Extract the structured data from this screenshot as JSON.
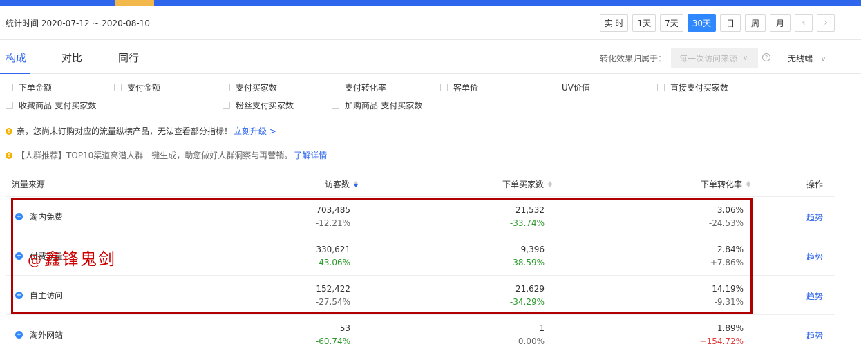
{
  "header": {
    "stats_time": "统计时间 2020-07-12 ~ 2020-08-10",
    "time_buttons": [
      {
        "label": "实 时",
        "active": false
      },
      {
        "label": "1天",
        "active": false
      },
      {
        "label": "7天",
        "active": false
      },
      {
        "label": "30天",
        "active": true
      },
      {
        "label": "日",
        "active": false
      },
      {
        "label": "周",
        "active": false
      },
      {
        "label": "月",
        "active": false
      }
    ],
    "prev_icon": "chevron-left-icon",
    "next_icon": "chevron-right-icon"
  },
  "tabs": {
    "items": [
      {
        "label": "构成",
        "active": true
      },
      {
        "label": "对比",
        "active": false
      },
      {
        "label": "同行",
        "active": false
      }
    ],
    "attribution_label": "转化效果归属于：",
    "attribution_value": "每一次访问来源",
    "device_value": "无线端"
  },
  "metrics": [
    {
      "label": "下单金额",
      "checked": false
    },
    {
      "label": "支付金额",
      "checked": false
    },
    {
      "label": "支付买家数",
      "checked": false
    },
    {
      "label": "支付转化率",
      "checked": false
    },
    {
      "label": "客单价",
      "checked": false
    },
    {
      "label": "UV价值",
      "checked": false
    },
    {
      "label": "直接支付买家数",
      "checked": false
    },
    {
      "label": "收藏商品-支付买家数",
      "checked": false
    },
    {
      "label": "粉丝支付买家数",
      "checked": false
    },
    {
      "label": "加购商品-支付买家数",
      "checked": false
    }
  ],
  "notices": {
    "n1_text": "亲，您尚未订购对应的流量纵横产品，无法查看部分指标！",
    "n1_link": "立刻升级 >",
    "n2_text": "【人群推荐】TOP10渠道高潜人群一键生成，助您做好人群洞察与再营销。",
    "n2_link": "了解详情"
  },
  "table": {
    "headers": {
      "source": "流量来源",
      "visitors": "访客数",
      "buyers": "下单买家数",
      "conversion": "下单转化率",
      "action": "操作"
    },
    "rows": [
      {
        "name": "淘内免费",
        "visitors": "703,485",
        "visitors_chg": "-12.21%",
        "buyers": "21,532",
        "buyers_chg": "-33.74%",
        "conv": "3.06%",
        "conv_chg": "-24.53%",
        "action": "趋势"
      },
      {
        "name": "付费流量",
        "visitors": "330,621",
        "visitors_chg": "-43.06%",
        "buyers": "9,396",
        "buyers_chg": "-38.59%",
        "conv": "2.84%",
        "conv_chg": "+7.86%",
        "action": "趋势"
      },
      {
        "name": "自主访问",
        "visitors": "152,422",
        "visitors_chg": "-27.54%",
        "buyers": "21,629",
        "buyers_chg": "-34.29%",
        "conv": "14.19%",
        "conv_chg": "-9.31%",
        "action": "趋势"
      },
      {
        "name": "淘外网站",
        "visitors": "53",
        "visitors_chg": "-60.74%",
        "buyers": "1",
        "buyers_chg": "0.00%",
        "conv": "1.89%",
        "conv_chg": "+154.72%",
        "action": "趋势"
      }
    ]
  },
  "watermark": {
    "at": "@",
    "text": "鑫锋鬼剑"
  },
  "colors": {
    "accent": "#2f66ee",
    "active_button": "#2f88ff",
    "annotation": "#b00000",
    "green": "#2d9a2d",
    "red": "#e23b3b"
  }
}
